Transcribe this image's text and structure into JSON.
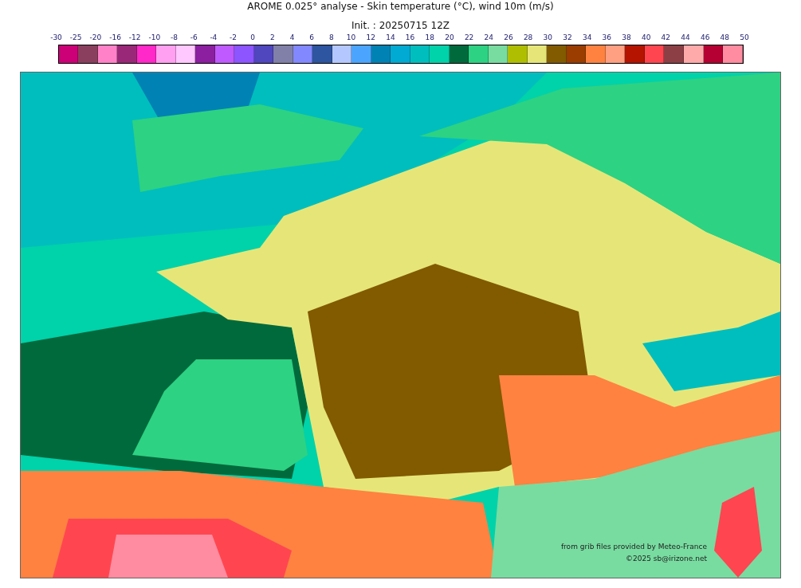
{
  "title": "AROME 0.025° analyse - Skin temperature (°C), wind 10m (m/s)",
  "subtitle": "Init. : 20250715 12Z",
  "legend": {
    "labels": [
      "-30",
      "-25",
      "-20",
      "-16",
      "-12",
      "-10",
      "-8",
      "-6",
      "-4",
      "-2",
      "0",
      "2",
      "4",
      "6",
      "8",
      "10",
      "12",
      "14",
      "16",
      "18",
      "20",
      "22",
      "24",
      "26",
      "28",
      "30",
      "32",
      "34",
      "36",
      "38",
      "40",
      "42",
      "44",
      "46",
      "48",
      "50"
    ],
    "swatches": [
      {
        "color": "#cc0077"
      },
      {
        "color": "#8b3f5e"
      },
      {
        "color": "#ff82c8"
      },
      {
        "color": "#9a2878"
      },
      {
        "color": "#ff28c8"
      },
      {
        "color": "#ffa0f0"
      },
      {
        "color": "#ffc8ff"
      },
      {
        "color": "#8c1ea0"
      },
      {
        "color": "#be5aff"
      },
      {
        "color": "#8c55ff"
      },
      {
        "color": "#5046be"
      },
      {
        "color": "#8080a8"
      },
      {
        "color": "#8288ff"
      },
      {
        "color": "#2d55a0"
      },
      {
        "color": "#b4c8ff"
      },
      {
        "color": "#4ba5ff"
      },
      {
        "color": "#0082b4"
      },
      {
        "color": "#00aad2"
      },
      {
        "color": "#00bebe"
      },
      {
        "color": "#00d2aa"
      },
      {
        "color": "#006a3c"
      },
      {
        "color": "#2dd282"
      },
      {
        "color": "#78dca0"
      },
      {
        "color": "#afbe00"
      },
      {
        "color": "#e6e678"
      },
      {
        "color": "#825a00"
      },
      {
        "color": "#9b3c00"
      },
      {
        "color": "#ff8241"
      },
      {
        "color": "#ffa082"
      },
      {
        "color": "#b41400"
      },
      {
        "color": "#ff4650"
      },
      {
        "color": "#8c4046"
      },
      {
        "color": "#ffaaaa"
      },
      {
        "color": "#b40032"
      },
      {
        "color": "#ff8ca0"
      }
    ]
  },
  "credits": [
    "from grib files provided by Meteo-France",
    "©2025 sb@irizone.net"
  ]
}
